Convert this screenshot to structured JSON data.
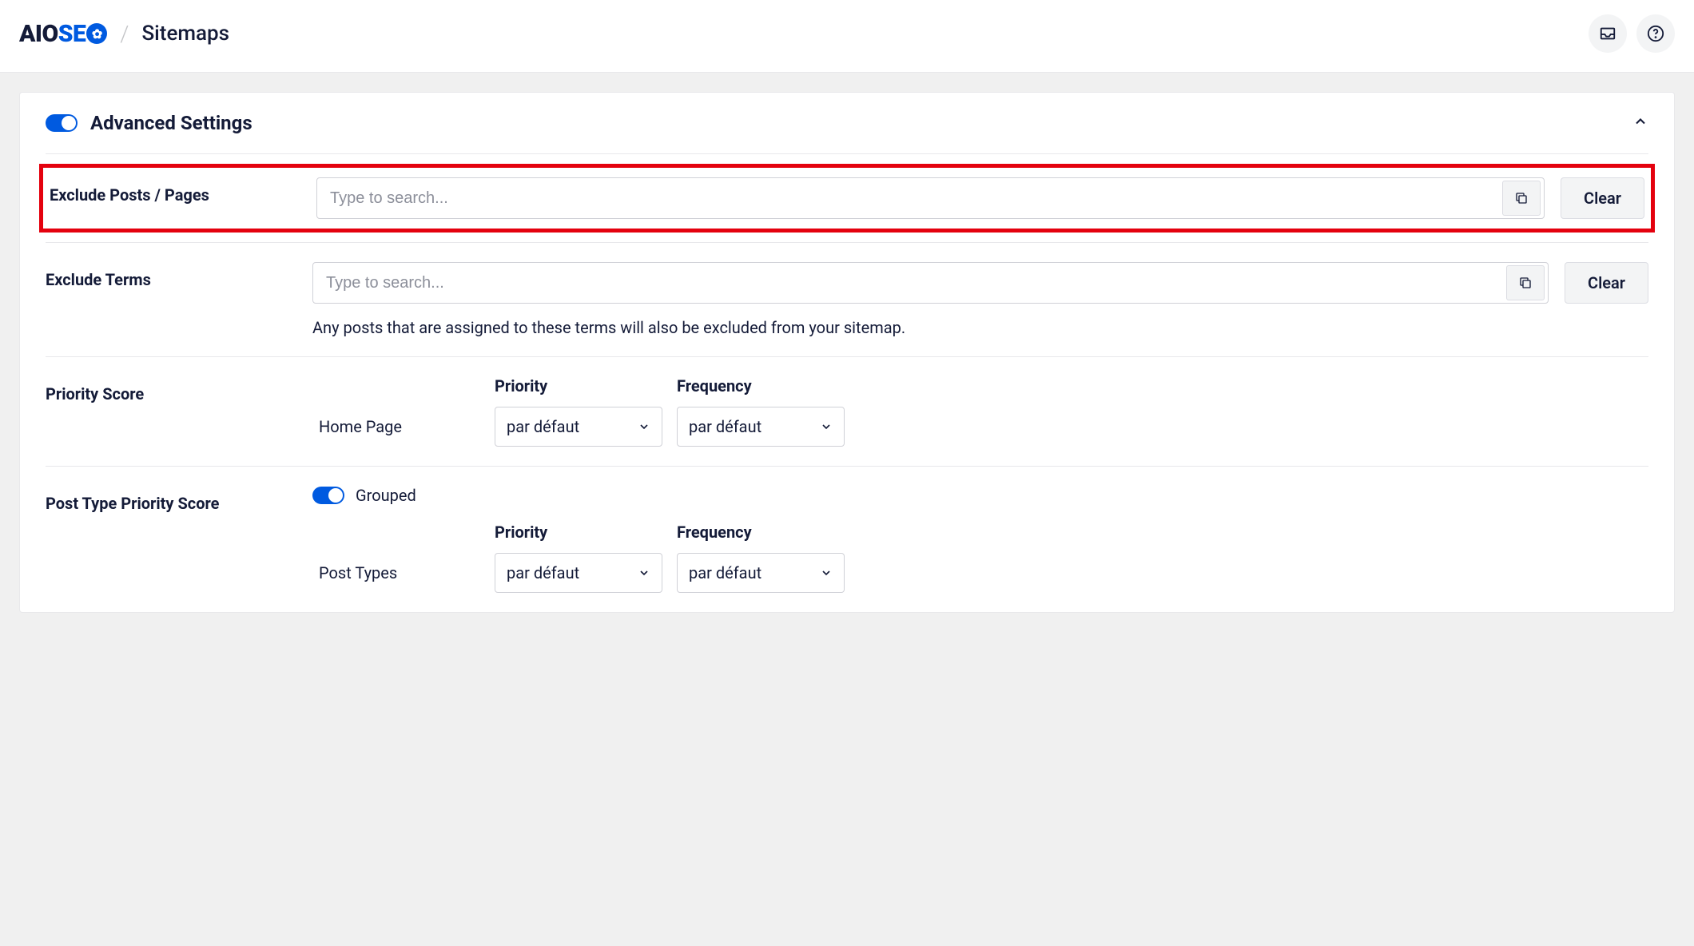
{
  "header": {
    "logo_aio": "AIO",
    "logo_se": "SE",
    "page_title": "Sitemaps"
  },
  "card": {
    "title": "Advanced Settings"
  },
  "exclude_posts": {
    "label": "Exclude Posts / Pages",
    "placeholder": "Type to search...",
    "clear": "Clear"
  },
  "exclude_terms": {
    "label": "Exclude Terms",
    "placeholder": "Type to search...",
    "clear": "Clear",
    "hint": "Any posts that are assigned to these terms will also be excluded from your sitemap."
  },
  "priority_score": {
    "label": "Priority Score",
    "col_priority": "Priority",
    "col_frequency": "Frequency",
    "row1_label": "Home Page",
    "row1_priority": "par défaut",
    "row1_frequency": "par défaut"
  },
  "post_type_priority": {
    "label": "Post Type Priority Score",
    "grouped": "Grouped",
    "col_priority": "Priority",
    "col_frequency": "Frequency",
    "row1_label": "Post Types",
    "row1_priority": "par défaut",
    "row1_frequency": "par défaut"
  }
}
